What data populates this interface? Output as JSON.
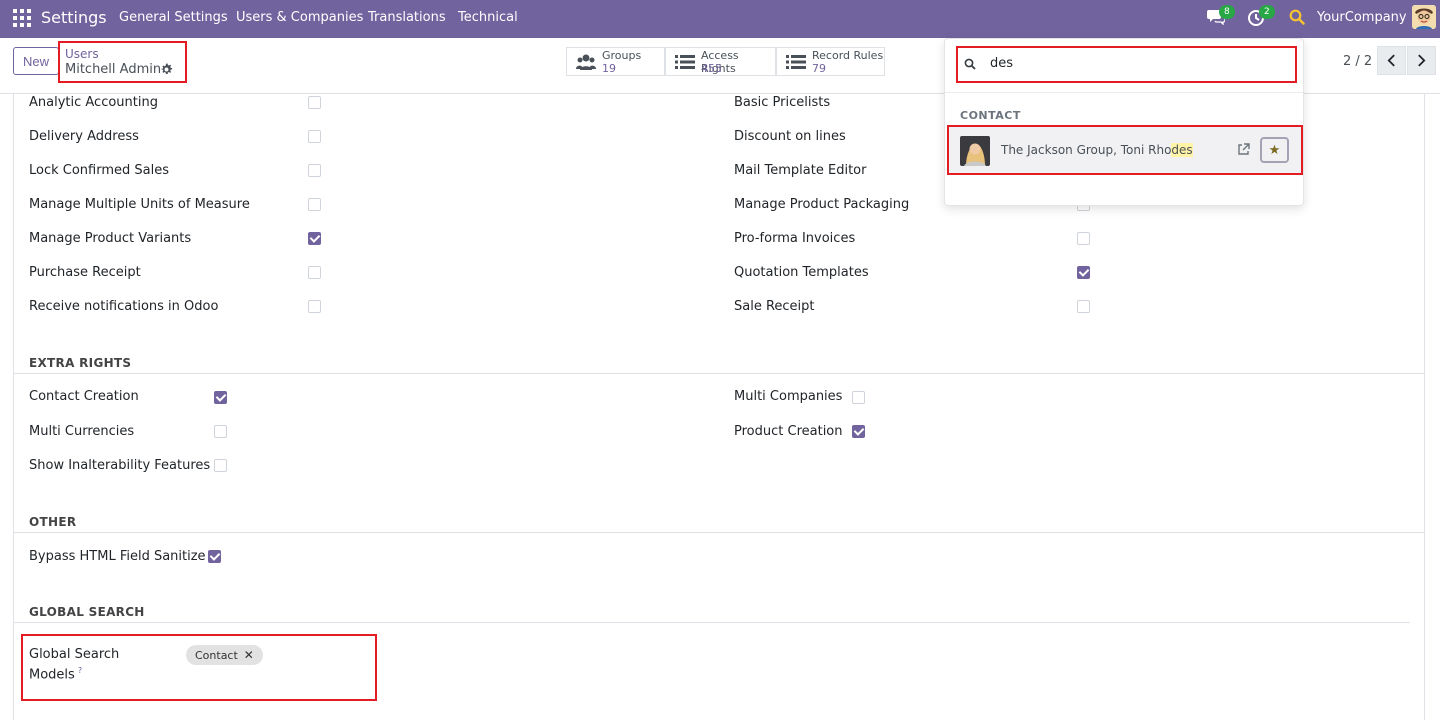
{
  "navbar": {
    "brand": "Settings",
    "menu": [
      "General Settings",
      "Users & Companies",
      "Translations",
      "Technical"
    ],
    "chat_count": "8",
    "activity_count": "2",
    "company": "YourCompany"
  },
  "control": {
    "new_label": "New",
    "breadcrumb_parent": "Users",
    "breadcrumb_current": "Mitchell Admin",
    "stats": [
      {
        "label": "Groups",
        "value": "19",
        "icon": "users-icon"
      },
      {
        "label": "Access Rights",
        "value": "455",
        "icon": "list-icon"
      },
      {
        "label": "Record Rules",
        "value": "79",
        "icon": "list-icon"
      }
    ],
    "pager": "2 / 2"
  },
  "sales_left": [
    {
      "label": "Analytic Accounting",
      "checked": false
    },
    {
      "label": "Delivery Address",
      "checked": false
    },
    {
      "label": "Lock Confirmed Sales",
      "checked": false
    },
    {
      "label": "Manage Multiple Units of Measure",
      "checked": false
    },
    {
      "label": "Manage Product Variants",
      "checked": true
    },
    {
      "label": "Purchase Receipt",
      "checked": false
    },
    {
      "label": "Receive notifications in Odoo",
      "checked": false
    }
  ],
  "sales_right": [
    {
      "label": "Basic Pricelists",
      "checked": false
    },
    {
      "label": "Discount on lines",
      "checked": false
    },
    {
      "label": "Mail Template Editor",
      "checked": false
    },
    {
      "label": "Manage Product Packaging",
      "checked": false
    },
    {
      "label": "Pro-forma Invoices",
      "checked": false
    },
    {
      "label": "Quotation Templates",
      "checked": true
    },
    {
      "label": "Sale Receipt",
      "checked": false
    }
  ],
  "extra_rights": {
    "title": "EXTRA RIGHTS",
    "left": [
      {
        "label": "Contact Creation",
        "checked": true
      },
      {
        "label": "Multi Currencies",
        "checked": false
      },
      {
        "label": "Show Inalterability Features",
        "checked": false
      }
    ],
    "right": [
      {
        "label": "Multi Companies",
        "checked": false
      },
      {
        "label": "Product Creation",
        "checked": true
      }
    ]
  },
  "other": {
    "title": "OTHER",
    "items": [
      {
        "label": "Bypass HTML Field Sanitize",
        "checked": true
      }
    ]
  },
  "global_search": {
    "title": "GLOBAL SEARCH",
    "field_label_1": "Global Search",
    "field_label_2": "Models",
    "help_mark": "?",
    "tag": "Contact",
    "tag_remove": "✕"
  },
  "dropdown": {
    "query": "des",
    "section": "CONTACT",
    "result_prefix": "The Jackson Group, Toni Rho",
    "result_highlight": "des",
    "star": "★"
  }
}
